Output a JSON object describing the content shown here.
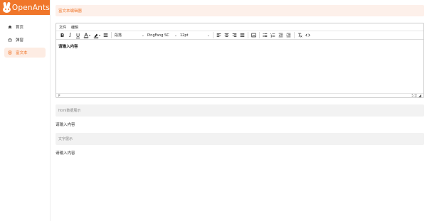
{
  "app": {
    "logo_text": "OpenAnts",
    "brand_color": "#f0762a"
  },
  "sidebar": {
    "items": [
      {
        "label": "首页",
        "icon": "home-icon",
        "active": false
      },
      {
        "label": "弹窗",
        "icon": "popup-icon",
        "active": false
      },
      {
        "label": "富文本",
        "icon": "richtext-icon",
        "active": true
      }
    ]
  },
  "page": {
    "title": "富文本编辑器"
  },
  "editor": {
    "menu": [
      "文件",
      "编辑"
    ],
    "block_format": "段落",
    "font_family": "PingFang SC",
    "font_size": "12pt",
    "content": "请输入内容",
    "status_left": "P",
    "word_count": "5 字"
  },
  "html_preview": {
    "label": "html数据展示",
    "value": "请输入内容"
  },
  "text_preview": {
    "label": "文字展示",
    "value": "请输入内容"
  }
}
